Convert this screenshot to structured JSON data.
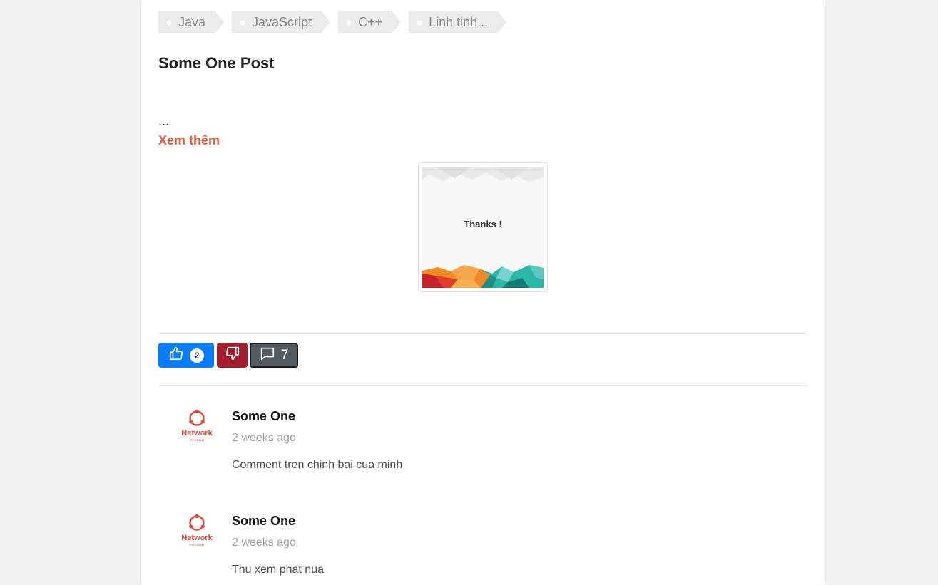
{
  "tags": [
    {
      "label": "Java"
    },
    {
      "label": "JavaScript"
    },
    {
      "label": "C++"
    },
    {
      "label": "Linh tinh..."
    }
  ],
  "post": {
    "title": "Some One Post",
    "excerpt": "...",
    "read_more": "Xem thêm",
    "image_caption": "Thanks !"
  },
  "actions": {
    "like_count": "2",
    "comment_count": "7",
    "like_color": "#0a7cf8",
    "dislike_color": "#a01e2d",
    "comment_color": "#545b62"
  },
  "comments": [
    {
      "author": "Some One",
      "time": "2 weeks ago",
      "text": "Comment tren chinh bai cua minh",
      "avatar_text": "Network",
      "avatar_subtext": "PROGRAM"
    },
    {
      "author": "Some One",
      "time": "2 weeks ago",
      "text": "Thu xem phat nua",
      "avatar_text": "Network",
      "avatar_subtext": "PROGRAM"
    }
  ],
  "colors": {
    "accent": "#e4593b",
    "background": "#f1f1f1"
  }
}
